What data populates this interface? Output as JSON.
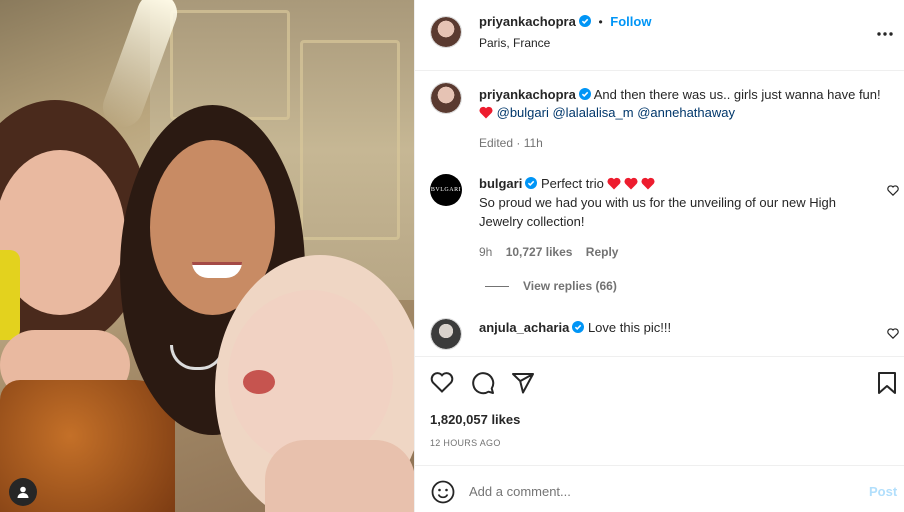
{
  "post": {
    "username": "priyankachopra",
    "follow_label": "Follow",
    "separator": "•",
    "location": "Paris, France",
    "more_icon": "more-horizontal-icon"
  },
  "caption": {
    "username": "priyankachopra",
    "text": "And then there was us.. girls just wanna have fun!",
    "mentions": [
      "@bulgari",
      "@lalalalisa_m",
      "@annehathaway"
    ],
    "meta": "Edited · 11h"
  },
  "comments": [
    {
      "username": "bulgari",
      "avatar_text": "BVLGARI",
      "text_line1": "Perfect trio",
      "text_line2": "So proud we had you with us for the unveiling of our new High Jewelry collection!",
      "time": "9h",
      "likes": "10,727 likes",
      "reply_label": "Reply",
      "view_replies": "View replies (66)"
    },
    {
      "username": "anjula_acharia",
      "text": "Love this pic!!!"
    }
  ],
  "actions": {
    "likes": "1,820,057 likes",
    "timestamp": "12 HOURS AGO"
  },
  "add_comment": {
    "placeholder": "Add a comment...",
    "post_label": "Post"
  },
  "colors": {
    "accent": "#0095f6",
    "verified": "#0095f6",
    "heart": "#ed1c2e",
    "link": "#00376b",
    "muted": "#737373"
  }
}
